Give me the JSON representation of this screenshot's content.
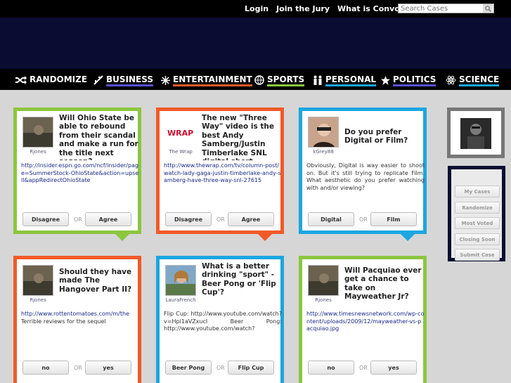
{
  "topbar": {
    "links": [
      "Login",
      "Join the Jury",
      "What is Convote?"
    ],
    "search_placeholder": "Search Cases"
  },
  "nav": [
    {
      "label": "RANDOMIZE",
      "icon": "shuffle-icon",
      "color": "#000000"
    },
    {
      "label": "BUSINESS",
      "icon": "airplane-icon",
      "color": "#5a4fd0"
    },
    {
      "label": "ENTERTAINMENT",
      "icon": "starburst-icon",
      "color": "#f05a28"
    },
    {
      "label": "SPORTS",
      "icon": "ball-icon",
      "color": "#8cc63f"
    },
    {
      "label": "PERSONAL",
      "icon": "people-icon",
      "color": "#1ca6e0"
    },
    {
      "label": "POLITICS",
      "icon": "star-icon",
      "color": "#5a4fd0"
    },
    {
      "label": "SCIENCE",
      "icon": "atom-icon",
      "color": "#1ca6e0"
    }
  ],
  "cards": [
    {
      "user": "Rjones",
      "question": "Will Ohio State be able to rebound from their scandal and make a run for the title next season?",
      "description": "",
      "link": "http://insider.espn.go.com/ncf/insider/page=SummerStock-OhioState&action=upsell&appRedirectOhioState",
      "option_a": "Disagree",
      "option_b": "Agree",
      "color": "#8cc63f"
    },
    {
      "user": "The Wrap",
      "question": "The new \"Three Way\" video is the best Andy Samberg/Justin Timberlake SNL digital short...",
      "description": "",
      "link": "http://www.thewrap.com/tv/column-post/watch-lady-gaga-justin-timberlake-andy-samberg-have-three-way-snl-27615",
      "option_a": "Disagree",
      "option_b": "Agree",
      "color": "#f05a28"
    },
    {
      "user": "kGrey88",
      "question": "Do you prefer Digital or Film?",
      "description": "Obviously, Digital is way easier to shoot on. But it's still trying to replicate Film. What aesthetic do you prefer watching with and/or viewing?",
      "link": "",
      "option_a": "Digital",
      "option_b": "Film",
      "color": "#1ca6e0"
    },
    {
      "user": "Rjones",
      "question": "Should they have made The Hangover Part II?",
      "description": "Terrible reviews for the sequel",
      "link": "http://www.rottentomatoes.com/m/the",
      "option_a": "no",
      "option_b": "yes",
      "color": "#f05a28"
    },
    {
      "user": "LauraFrench",
      "question": "What is a better drinking \"sport\" - Beer Pong or 'Flip Cup'?",
      "description": "Flip Cup: http://www.youtube.com/watch?v=Hpi1aVZxucI Beer Pong: http://www.youtube.com/watch?",
      "link": "",
      "option_a": "Beer Pong",
      "option_b": "Flip Cup",
      "color": "#1ca6e0"
    },
    {
      "user": "Rjones",
      "question": "Will Pacquiao ever get a chance to take on Mayweather Jr?",
      "description": "",
      "link": "http://www.timesnewsnetwork.com/wp-content/uploads/2009/12/mayweather-vs-pacquiao.jpg",
      "option_a": "no",
      "option_b": "yes",
      "color": "#8cc63f"
    }
  ],
  "or_label": "OR",
  "sidebar": {
    "buttons": [
      "My Cases",
      "Randomize",
      "Most Voted",
      "Closing Soon",
      "Submit Case"
    ]
  }
}
